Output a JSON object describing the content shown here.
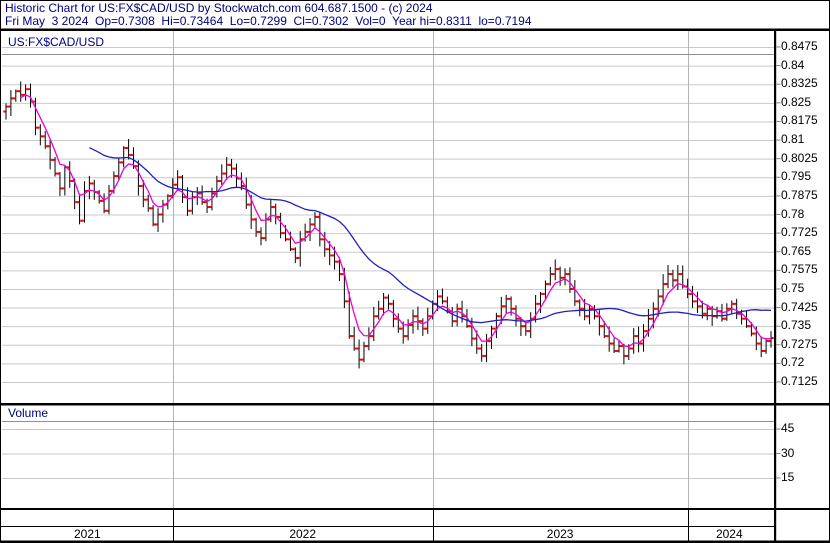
{
  "header": {
    "line1": "Historic Chart for US:FX$CAD/USD by Stockwatch.com 604.687.1500 - (c) 2024",
    "line2": "Fri May  3 2024  Op=0.7308  Hi=0.73464  Lo=0.7299  Cl=0.7302  Vol=0  Year hi=0.8311  lo=0.7194"
  },
  "price_pane": {
    "title": "US:FX$CAD/USD",
    "y_axis_labels": [
      "0.8475",
      "0.84",
      "0.8325",
      "0.825",
      "0.8175",
      "0.81",
      "0.8025",
      "0.795",
      "0.7875",
      "0.78",
      "0.7725",
      "0.765",
      "0.7575",
      "0.75",
      "0.7425",
      "0.735",
      "0.7275",
      "0.72",
      "0.7125"
    ]
  },
  "volume_pane": {
    "title": "Volume",
    "y_axis_labels": [
      "45",
      "30",
      "15"
    ]
  },
  "x_axis": {
    "year_labels": [
      "2021",
      "2022",
      "2023",
      "2024"
    ]
  },
  "colors": {
    "header_text": "#000080",
    "axis_text": "#000000",
    "bar": "#000000",
    "open_close_tick": "#ff0000",
    "ma_short": "#f000d8",
    "ma_long": "#2020c0",
    "grid": "#c9c9c9",
    "year_divider": "#b4b4b4",
    "border": "#000000"
  },
  "chart_data": {
    "type": "ohlc",
    "symbol": "US:FX$CAD/USD",
    "frequency": "weekly",
    "title": "Historic Chart for US:FX$CAD/USD",
    "y_axis": {
      "max": 0.8475,
      "min": 0.7125,
      "step": 0.0075
    },
    "volume_axis": {
      "labels": [
        45,
        30,
        15
      ],
      "all_volumes_zero": true
    },
    "last_bar": {
      "date": "Fri May 3 2024",
      "open": 0.7308,
      "high": 0.73464,
      "low": 0.7299,
      "close": 0.7302,
      "volume": 0
    },
    "year_high": 0.8311,
    "year_low": 0.7194,
    "year_start_indices": [
      0,
      34,
      87,
      139
    ],
    "series": [
      {
        "name": "weekly close",
        "role": "ohlc-bars"
      },
      {
        "name": "short moving average",
        "role": "ma_short",
        "est_weeks": 5
      },
      {
        "name": "long moving average",
        "role": "ma_long",
        "est_weeks": 26,
        "starts_at_index": 17
      }
    ],
    "closes": [
      0.8235,
      0.8268,
      0.8297,
      0.8282,
      0.8305,
      0.8255,
      0.815,
      0.8115,
      0.8075,
      0.802,
      0.7965,
      0.7905,
      0.799,
      0.7935,
      0.785,
      0.7775,
      0.7895,
      0.7925,
      0.789,
      0.7855,
      0.7815,
      0.7895,
      0.7955,
      0.801,
      0.8068,
      0.804,
      0.7995,
      0.7915,
      0.786,
      0.7825,
      0.776,
      0.78,
      0.784,
      0.7875,
      0.792,
      0.795,
      0.787,
      0.7815,
      0.787,
      0.7885,
      0.785,
      0.783,
      0.7885,
      0.7935,
      0.7965,
      0.8,
      0.7985,
      0.7945,
      0.7915,
      0.784,
      0.778,
      0.773,
      0.7705,
      0.778,
      0.783,
      0.779,
      0.7725,
      0.77,
      0.766,
      0.7625,
      0.77,
      0.773,
      0.776,
      0.779,
      0.77,
      0.766,
      0.7635,
      0.761,
      0.756,
      0.745,
      0.731,
      0.726,
      0.7215,
      0.727,
      0.731,
      0.739,
      0.742,
      0.7465,
      0.744,
      0.738,
      0.734,
      0.731,
      0.7355,
      0.739,
      0.737,
      0.734,
      0.739,
      0.744,
      0.747,
      0.745,
      0.741,
      0.737,
      0.742,
      0.739,
      0.735,
      0.73,
      0.726,
      0.723,
      0.729,
      0.734,
      0.739,
      0.743,
      0.746,
      0.742,
      0.738,
      0.735,
      0.733,
      0.738,
      0.744,
      0.748,
      0.752,
      0.756,
      0.758,
      0.7545,
      0.756,
      0.75,
      0.745,
      0.742,
      0.739,
      0.742,
      0.739,
      0.735,
      0.731,
      0.728,
      0.725,
      0.727,
      0.723,
      0.726,
      0.731,
      0.728,
      0.733,
      0.738,
      0.742,
      0.747,
      0.752,
      0.756,
      0.7535,
      0.756,
      0.751,
      0.748,
      0.745,
      0.743,
      0.74,
      0.742,
      0.739,
      0.741,
      0.738,
      0.742,
      0.744,
      0.74,
      0.738,
      0.735,
      0.732,
      0.728,
      0.725,
      0.729,
      0.7302
    ]
  }
}
